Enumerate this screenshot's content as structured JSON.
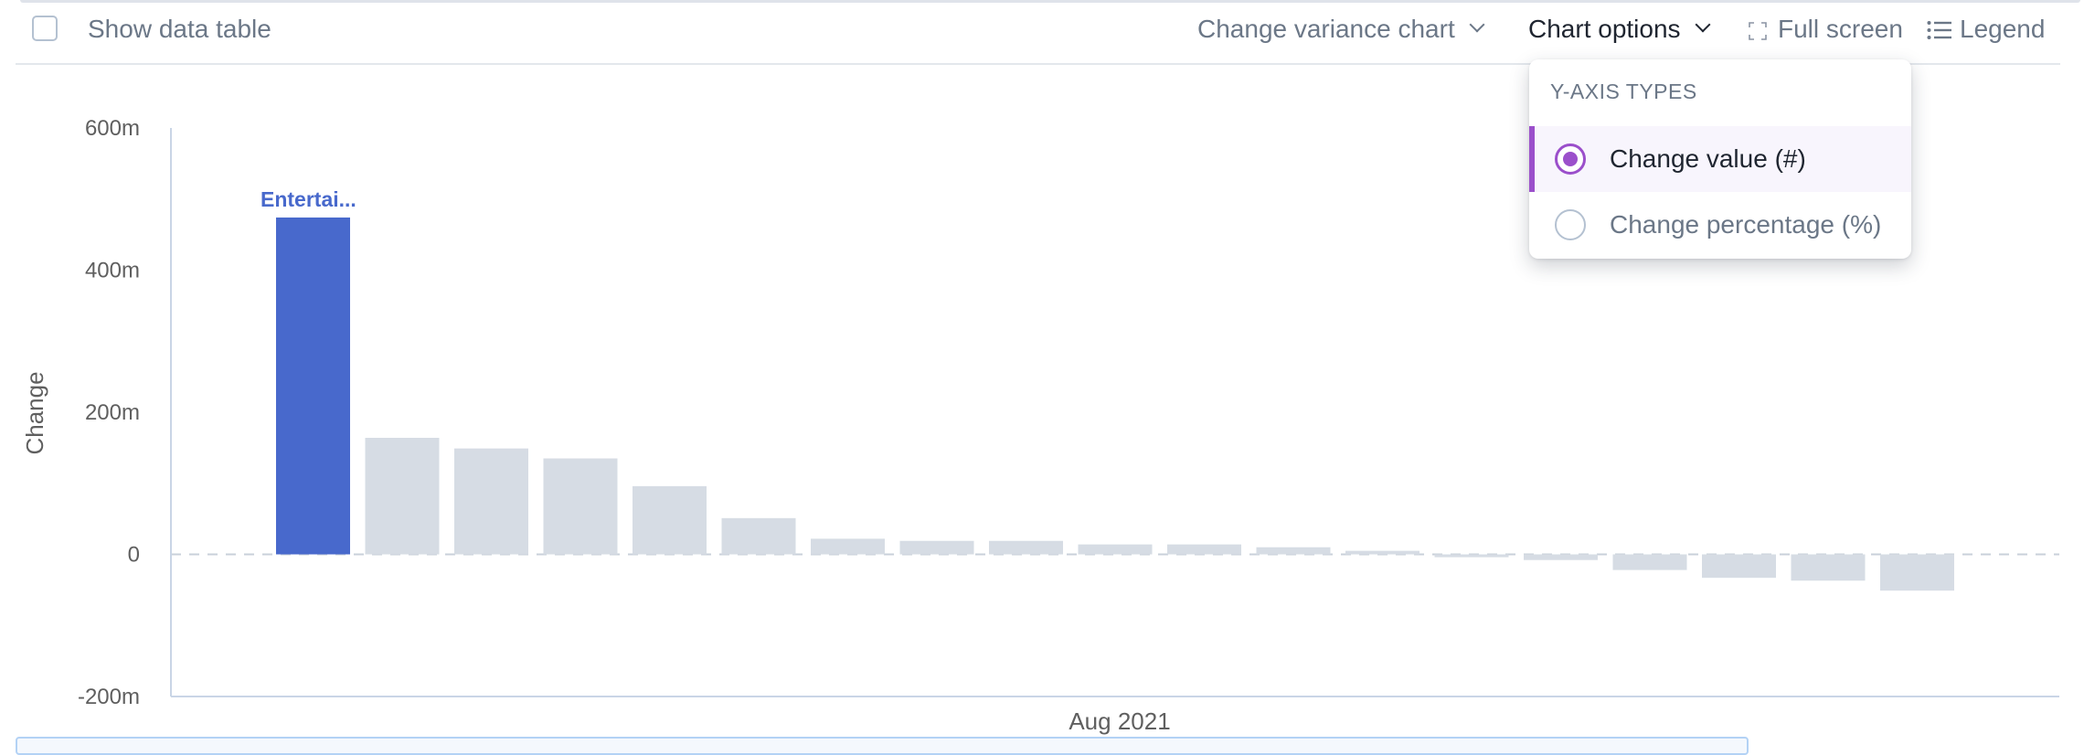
{
  "toolbar": {
    "show_data_table_label": "Show data table",
    "show_data_table_checked": false,
    "chart_type_label": "Change variance chart",
    "chart_options_label": "Chart options",
    "full_screen_label": "Full screen",
    "legend_label": "Legend",
    "icons": {
      "chart_type": "chevron-down-icon",
      "chart_options": "chevron-down-icon",
      "full_screen": "fullscreen-icon",
      "legend": "list-icon"
    }
  },
  "chart_options_menu": {
    "header": "Y-AXIS TYPES",
    "options": [
      {
        "label": "Change value (#)",
        "selected": true
      },
      {
        "label": "Change percentage (%)",
        "selected": false
      }
    ],
    "accent_color": "#9b4fcb"
  },
  "colors": {
    "highlight_bar": "#4869cc",
    "bar": "#d6dce4",
    "axis": "#c9d5e6",
    "zero_line": "#c9d0da"
  },
  "chart_data": {
    "type": "bar",
    "title": "",
    "xlabel": "Aug 2021",
    "ylabel": "Change",
    "ylim": [
      -200,
      600
    ],
    "y_unit": "m",
    "yticks": [
      {
        "value": 600,
        "label": "600m"
      },
      {
        "value": 400,
        "label": "400m"
      },
      {
        "value": 200,
        "label": "200m"
      },
      {
        "value": 0,
        "label": "0"
      },
      {
        "value": -200,
        "label": "-200m"
      }
    ],
    "grid": false,
    "zero_line": "dashed",
    "highlighted_index": 0,
    "highlighted_label": "Entertai...",
    "values": [
      474,
      164,
      149,
      135,
      96,
      51,
      22,
      19,
      19,
      14,
      14,
      10,
      5,
      -4,
      -8,
      -22,
      -33,
      -37,
      -51
    ]
  }
}
